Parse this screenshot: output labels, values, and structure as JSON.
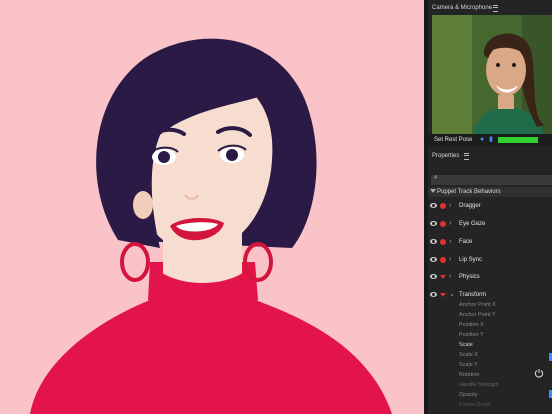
{
  "camera_panel": {
    "title": "Camera & Microphone",
    "set_rest_pose": "Set Rest Pose"
  },
  "properties_panel": {
    "title": "Properties",
    "search_glyph": "⌕",
    "group_label": "Puppet Track Behaviors",
    "behaviors": [
      {
        "label": "Dragger",
        "icon": "record-dot"
      },
      {
        "label": "Eye Gaze",
        "icon": "record-dot"
      },
      {
        "label": "Face",
        "icon": "record-dot"
      },
      {
        "label": "Lip Sync",
        "icon": "record-dot"
      },
      {
        "label": "Physics",
        "icon": "record-triangle"
      },
      {
        "label": "Transform",
        "icon": "record-triangle"
      }
    ],
    "transform_properties": [
      "Anchor Point X",
      "Anchor Point Y",
      "Position X",
      "Position Y",
      "Scale",
      "Scale X",
      "Scale Y",
      "Rotation",
      "Handle Strength",
      "Opacity",
      "Follow Depth"
    ]
  },
  "colors": {
    "stage_background": "#f9c3c8",
    "hair": "#2a1a45",
    "skin": "#f7ddcf",
    "shirt": "#e3144b",
    "lips": "#d4143c",
    "panel_background": "#242424",
    "record_red": "#e0332e",
    "mic_level_green": "#2fd02f",
    "accent_blue": "#3b8cff"
  }
}
